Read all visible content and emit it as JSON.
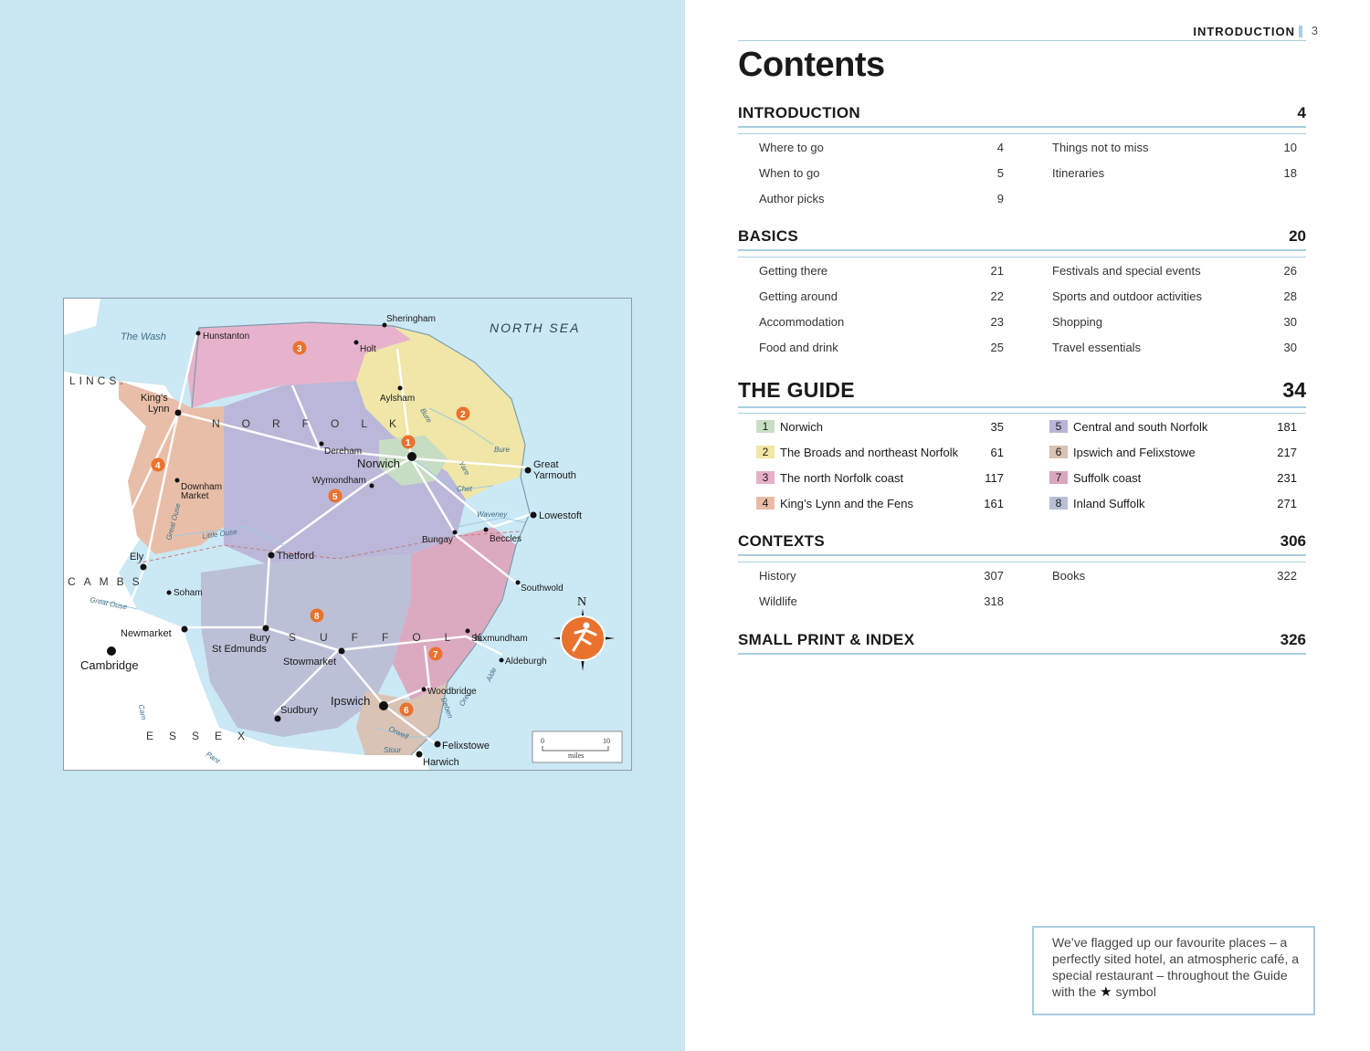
{
  "running_head": {
    "label": "INTRODUCTION",
    "page": "3"
  },
  "title": "Contents",
  "colors": {
    "page_blue": "#c8e7f3",
    "rule_blue": "#a9cde0",
    "chapter_colors": [
      "#c9dfc4",
      "#f1e6a6",
      "#e5b0c8",
      "#e7bca6",
      "#b9b5d9",
      "#d7c2b3",
      "#d9a8bd",
      "#b9bfd6"
    ],
    "badge_orange": "#e9722f"
  },
  "sections": {
    "introduction": {
      "title": "INTRODUCTION",
      "page": "4",
      "left": [
        {
          "label": "Where to go",
          "page": "4"
        },
        {
          "label": "When to go",
          "page": "5"
        },
        {
          "label": "Author picks",
          "page": "9"
        }
      ],
      "right": [
        {
          "label": "Things not to miss",
          "page": "10"
        },
        {
          "label": "Itineraries",
          "page": "18"
        }
      ]
    },
    "basics": {
      "title": "BASICS",
      "page": "20",
      "left": [
        {
          "label": "Getting there",
          "page": "21"
        },
        {
          "label": "Getting around",
          "page": "22"
        },
        {
          "label": "Accommodation",
          "page": "23"
        },
        {
          "label": "Food and drink",
          "page": "25"
        }
      ],
      "right": [
        {
          "label": "Festivals and special events",
          "page": "26"
        },
        {
          "label": "Sports and outdoor activities",
          "page": "28"
        },
        {
          "label": "Shopping",
          "page": "30"
        },
        {
          "label": "Travel essentials",
          "page": "30"
        }
      ]
    },
    "guide": {
      "title": "THE GUIDE",
      "page": "34",
      "left": [
        {
          "num": "1",
          "label": "Norwich",
          "page": "35"
        },
        {
          "num": "2",
          "label": "The Broads and northeast Norfolk",
          "page": "61"
        },
        {
          "num": "3",
          "label": "The north Norfolk coast",
          "page": "117"
        },
        {
          "num": "4",
          "label": "King’s Lynn and the Fens",
          "page": "161"
        }
      ],
      "right": [
        {
          "num": "5",
          "label": "Central and south Norfolk",
          "page": "181"
        },
        {
          "num": "6",
          "label": "Ipswich and Felixstowe",
          "page": "217"
        },
        {
          "num": "7",
          "label": "Suffolk coast",
          "page": "231"
        },
        {
          "num": "8",
          "label": "Inland Suffolk",
          "page": "271"
        }
      ]
    },
    "contexts": {
      "title": "CONTEXTS",
      "page": "306",
      "left": [
        {
          "label": "History",
          "page": "307"
        },
        {
          "label": "Wildlife",
          "page": "318"
        }
      ],
      "right": [
        {
          "label": "Books",
          "page": "322"
        }
      ]
    },
    "small_print": {
      "title": "SMALL PRINT & INDEX",
      "page": "326"
    }
  },
  "note": {
    "text_before": "We’ve flagged up our favourite places – a perfectly sited hotel, an atmospheric café, a special restaurant – throughout the Guide with the",
    "text_after": "symbol",
    "icon": "star-icon"
  },
  "map": {
    "sea_label": "NORTH SEA",
    "wash_label": "The Wash",
    "regions": {
      "lincs": "LINCS.",
      "norfolk": "NORFOLK",
      "cambs": "CAMBS",
      "suffolk": "SUFFOLK",
      "essex": "ESSEX"
    },
    "towns": {
      "sheringham": "Sheringham",
      "hunstanton": "Hunstanton",
      "holt": "Holt",
      "aylsham": "Aylsham",
      "kings_lynn_1": "King’s",
      "kings_lynn_2": "Lynn",
      "dereham": "Dereham",
      "norwich": "Norwich",
      "wymondham": "Wymondham",
      "great_yarmouth_1": "Great",
      "great_yarmouth_2": "Yarmouth",
      "downham_1": "Downham",
      "downham_2": "Market",
      "lowestoft": "Lowestoft",
      "bungay": "Bungay",
      "beccles": "Beccles",
      "ely": "Ely",
      "thetford": "Thetford",
      "southwold": "Southwold",
      "soham": "Soham",
      "newmarket": "Newmarket",
      "cambridge": "Cambridge",
      "bury_1": "Bury",
      "bury_2": "St Edmunds",
      "saxmundham": "Saxmundham",
      "stowmarket": "Stowmarket",
      "aldeburgh": "Aldeburgh",
      "woodbridge": "Woodbridge",
      "ipswich": "Ipswich",
      "sudbury": "Sudbury",
      "felixstowe": "Felixstowe",
      "harwich": "Harwich"
    },
    "rivers": {
      "bure_1": "Bure",
      "bure_2": "Bure",
      "yare": "Yare",
      "chet": "Chet",
      "waveney": "Waveney",
      "little_ouse": "Little Ouse",
      "great_ouse_1": "Great Ouse",
      "great_ouse_2": "Great Ouse",
      "cam": "Cam",
      "deben": "Deben",
      "ore": "Ore",
      "alde": "Alde",
      "orwell": "Orwell",
      "stour": "Stour",
      "pant": "Pant"
    },
    "badges": [
      "1",
      "2",
      "3",
      "4",
      "5",
      "6",
      "7",
      "8"
    ],
    "compass_label": "N",
    "scale": {
      "min": "0",
      "max": "10",
      "unit": "miles"
    }
  }
}
